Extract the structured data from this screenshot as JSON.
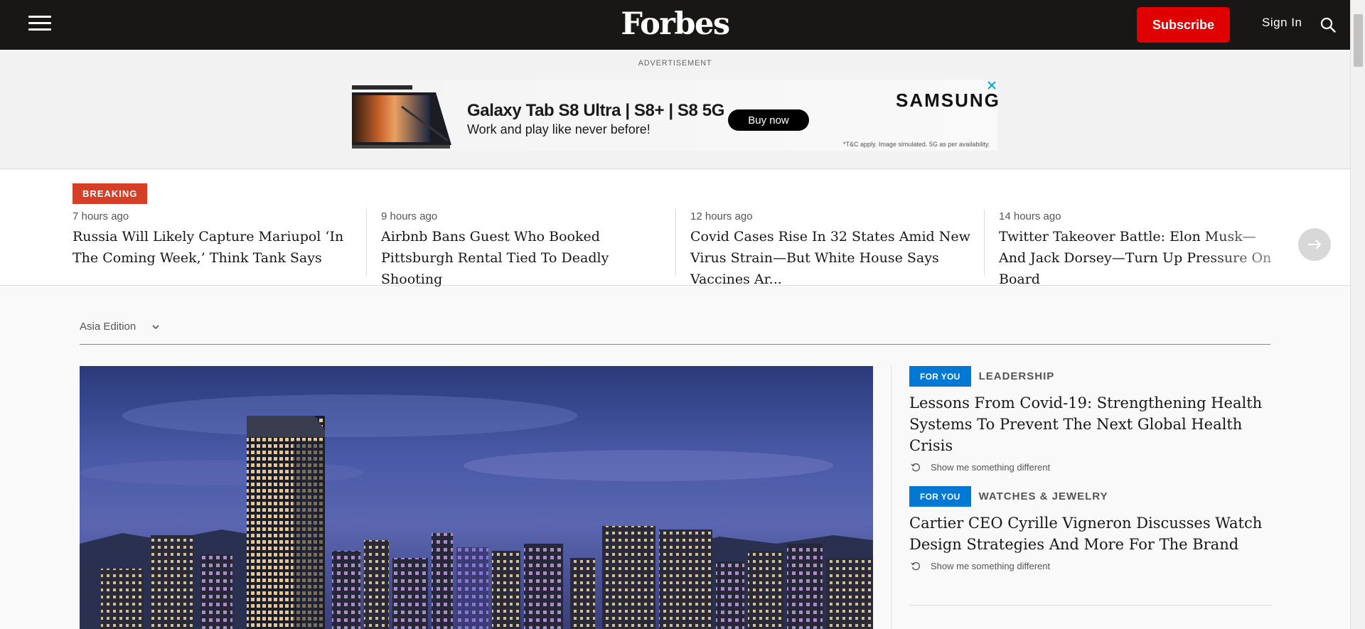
{
  "header": {
    "logo": "Forbes",
    "subscribe_label": "Subscribe",
    "signin_label": "Sign In",
    "colors": {
      "bar": "#181716",
      "subscribe": "#e00000"
    }
  },
  "ad": {
    "label": "ADVERTISEMENT",
    "title": "Galaxy Tab S8 Ultra | S8+ | S8 5G",
    "subtitle": "Work and play like never before!",
    "cta": "Buy now",
    "brand": "SAMSUNG",
    "fineprint": "*T&C apply. Image simulated. 5G as per availability."
  },
  "breaking": {
    "badge": "BREAKING",
    "badge_color": "#d53f27",
    "stories": [
      {
        "time": "7 hours ago",
        "title": "Russia Will Likely Capture Mariupol ‘In The Coming Week,’ Think Tank Says"
      },
      {
        "time": "9 hours ago",
        "title": "Airbnb Bans Guest Who Booked Pittsburgh Rental Tied To Deadly Shooting"
      },
      {
        "time": "12 hours ago",
        "title": "Covid Cases Rise In 32 States Amid New Virus Strain—But White House Says Vaccines Ar..."
      },
      {
        "time": "14 hours ago",
        "title": "Twitter Takeover Battle: Elon Musk—And Jack Dorsey—Turn Up Pressure On Board"
      }
    ]
  },
  "edition": {
    "label": "Asia Edition"
  },
  "side_stories": [
    {
      "tag": "FOR YOU",
      "category": "LEADERSHIP",
      "title": "Lessons From Covid-19: Strengthening Health Systems To Prevent The Next Global Health Crisis",
      "more": "Show me something different"
    },
    {
      "tag": "FOR YOU",
      "category": "WATCHES & JEWELRY",
      "title": "Cartier CEO Cyrille Vigneron Discusses Watch Design Strategies And More For The Brand",
      "more": "Show me something different"
    }
  ],
  "icons": [
    "hamburger-menu-icon",
    "search-icon",
    "ad-close-icon",
    "arrow-right-icon",
    "chevron-down-icon",
    "refresh-icon"
  ],
  "accent_color": "#0078d4"
}
